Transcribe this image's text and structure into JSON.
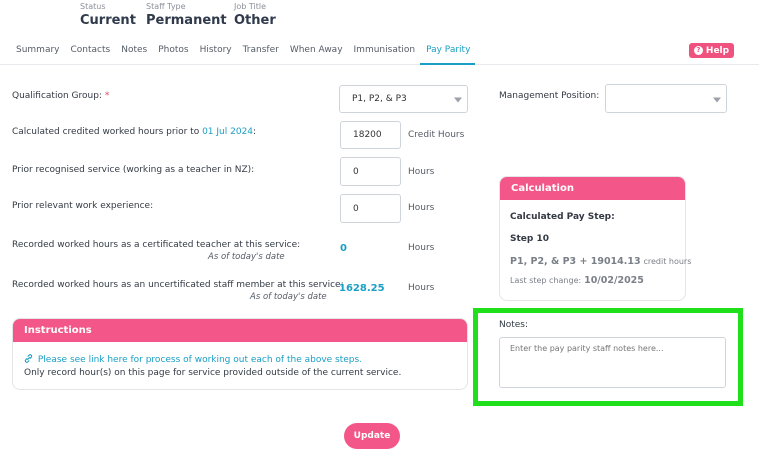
{
  "header": {
    "status_label": "Status",
    "status_value": "Current",
    "staff_type_label": "Staff Type",
    "staff_type_value": "Permanent",
    "job_title_label": "Job Title",
    "job_title_value": "Other"
  },
  "tabs": [
    {
      "label": "Summary"
    },
    {
      "label": "Contacts"
    },
    {
      "label": "Notes"
    },
    {
      "label": "Photos"
    },
    {
      "label": "History"
    },
    {
      "label": "Transfer"
    },
    {
      "label": "When Away"
    },
    {
      "label": "Immunisation"
    },
    {
      "label": "Pay Parity",
      "active": true
    }
  ],
  "help": {
    "label": "Help",
    "icon": "question-circle-icon"
  },
  "form": {
    "qualification_group_label": "Qualification Group:",
    "qualification_group_required": "*",
    "qualification_group_value": "P1, P2, & P3",
    "management_position_label": "Management Position:",
    "management_position_value": "",
    "credited_hours_label_prefix": "Calculated credited worked hours prior to",
    "credited_hours_label_date": "01 Jul 2024",
    "credited_hours_label_suffix": ":",
    "credited_hours_value": "18200",
    "credited_hours_unit": "Credit Hours",
    "prior_service_label": "Prior recognised service (working as a teacher in NZ):",
    "prior_service_value": "0",
    "prior_service_unit": "Hours",
    "prior_experience_label": "Prior relevant work experience:",
    "prior_experience_value": "0",
    "prior_experience_unit": "Hours",
    "cert_hours_label": "Recorded worked hours as a certificated teacher at this service:",
    "cert_hours_sub": "As of today's date",
    "cert_hours_value": "0",
    "cert_hours_unit": "Hours",
    "uncert_hours_label": "Recorded worked hours as an uncertificated staff member at this service:",
    "uncert_hours_sub": "As of today's date",
    "uncert_hours_value": "1628.25",
    "uncert_hours_unit": "Hours"
  },
  "calculation": {
    "title": "Calculation",
    "pay_step_label": "Calculated Pay Step:",
    "step": "Step 10",
    "detail_value": "P1, P2, & P3 + 19014.13",
    "detail_unit": "credit hours",
    "last_change_label": "Last step change:",
    "last_change_value": "10/02/2025"
  },
  "instructions": {
    "title": "Instructions",
    "link_icon": "link-icon",
    "link_text": "Please see link here for process of working out each of the above steps.",
    "note": "Only record hour(s) on this page for service provided outside of the current service."
  },
  "notes": {
    "label": "Notes:",
    "placeholder": "Enter the pay parity staff notes here..."
  },
  "update_label": "Update",
  "colors": {
    "accent": "#1a9fc4",
    "brand_pink": "#f3578a",
    "highlight": "#1fe01b"
  }
}
